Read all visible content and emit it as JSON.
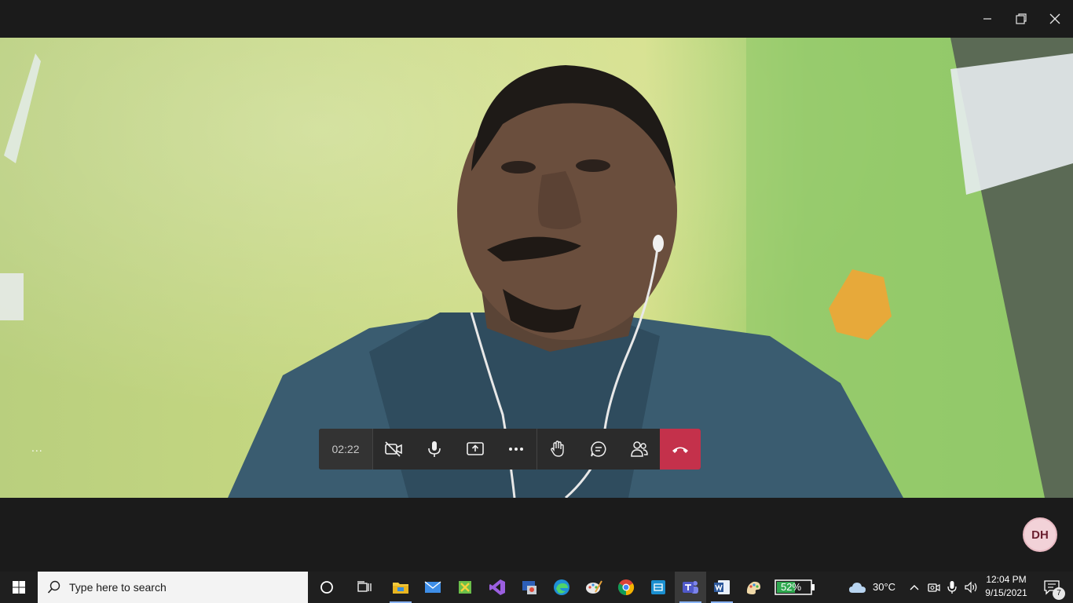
{
  "window": {
    "controls": [
      "minimize-icon",
      "restore-icon",
      "close-icon"
    ]
  },
  "call": {
    "timer": "02:22",
    "more_label": "...",
    "participant_initials": "DH",
    "hangup_color": "#c4314b"
  },
  "taskbar": {
    "search_placeholder": "Type here to search",
    "apps": [
      "file-explorer-icon",
      "mail-icon",
      "app-icon",
      "visual-studio-icon",
      "app-icon",
      "edge-icon",
      "paint-icon",
      "chrome-icon",
      "app-icon",
      "teams-icon",
      "word-icon",
      "paint-icon"
    ],
    "battery_percent": "52%",
    "weather": "30°C",
    "time": "12:04 PM",
    "date": "9/15/2021",
    "notifications_count": "7"
  }
}
